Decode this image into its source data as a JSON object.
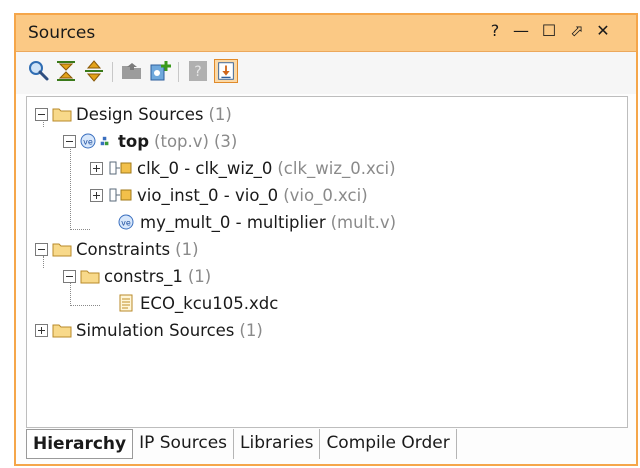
{
  "window": {
    "title": "Sources",
    "help": "?",
    "minimize": "—",
    "maximize": "☐",
    "float": "⬀",
    "close": "✕"
  },
  "toolbar": {
    "buttons": [
      "search-icon",
      "collapse-all-icon",
      "expand-all-icon",
      "open-folder-icon",
      "add-sources-icon",
      "help-icon",
      "show-hierarchy-icon"
    ]
  },
  "tree": {
    "design_sources": {
      "label": "Design Sources",
      "count": "(1)"
    },
    "top": {
      "label": "top",
      "file": "(top.v)",
      "count": "(3)"
    },
    "clk": {
      "label": "clk_0 - clk_wiz_0",
      "file": "(clk_wiz_0.xci)"
    },
    "vio": {
      "label": "vio_inst_0 - vio_0",
      "file": "(vio_0.xci)"
    },
    "mult": {
      "label": "my_mult_0 - multiplier",
      "file": "(mult.v)"
    },
    "constraints": {
      "label": "Constraints",
      "count": "(1)"
    },
    "constrs": {
      "label": "constrs_1",
      "count": "(1)"
    },
    "xdc": {
      "label": "ECO_kcu105.xdc"
    },
    "simulation": {
      "label": "Simulation Sources",
      "count": "(1)"
    }
  },
  "tabs": [
    "Hierarchy",
    "IP Sources",
    "Libraries",
    "Compile Order"
  ],
  "colors": {
    "accent": "#f5a64a",
    "titlebar": "#fbc985"
  }
}
